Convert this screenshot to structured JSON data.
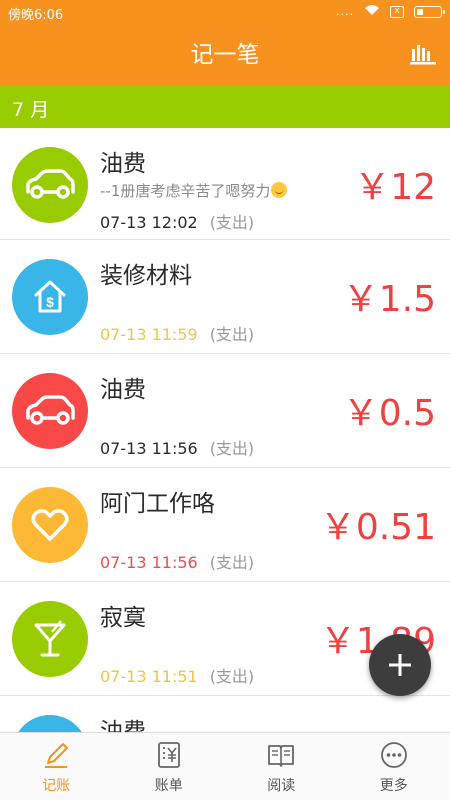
{
  "status_bar": {
    "time": "傍晚6:06",
    "signal": "....",
    "sim": "x"
  },
  "app_bar": {
    "title": "记一笔",
    "stats_icon": "bar-chart-icon"
  },
  "month": {
    "label": "7 月"
  },
  "colors": {
    "accent": "#f7921e",
    "month_bar": "#98cb00",
    "amount": "#f04040",
    "green": "#98cb00",
    "blue": "#39b5e8",
    "red": "#f84848",
    "yellow": "#fdb836"
  },
  "entries": [
    {
      "title": "油费",
      "note": "--1册唐考虑辛苦了嗯努力",
      "time": "07-13 12:02",
      "time_color": "#2a2a2a",
      "type": "(支出)",
      "amount": "￥12",
      "icon": "car-icon",
      "icon_color": "#98cb00"
    },
    {
      "title": "装修材料",
      "time": "07-13 11:59",
      "time_color": "#f4c24a",
      "type": "(支出)",
      "amount": "￥1.5",
      "icon": "house-dollar-icon",
      "icon_color": "#39b5e8"
    },
    {
      "title": "油费",
      "time": "07-13 11:56",
      "time_color": "#2a2a2a",
      "type": "(支出)",
      "amount": "￥0.5",
      "icon": "car-icon",
      "icon_color": "#f84848"
    },
    {
      "title": "阿门工作咯",
      "time": "07-13 11:56",
      "time_color": "#ef4d4d",
      "type": "(支出)",
      "amount": "￥0.51",
      "icon": "heart-icon",
      "icon_color": "#fdb836"
    },
    {
      "title": "寂寞",
      "time": "07-13 11:51",
      "time_color": "#f4c24a",
      "type": "(支出)",
      "amount": "￥1.89",
      "icon": "cocktail-icon",
      "icon_color": "#98cb00"
    },
    {
      "title": "油费",
      "icon": "car-icon",
      "icon_color": "#39b5e8"
    }
  ],
  "fab": {
    "icon": "plus-icon"
  },
  "bottom_nav": [
    {
      "label": "记账",
      "icon": "pen-icon",
      "active": true
    },
    {
      "label": "账单",
      "icon": "bill-icon",
      "active": false
    },
    {
      "label": "阅读",
      "icon": "book-icon",
      "active": false
    },
    {
      "label": "更多",
      "icon": "more-icon",
      "active": false
    }
  ]
}
